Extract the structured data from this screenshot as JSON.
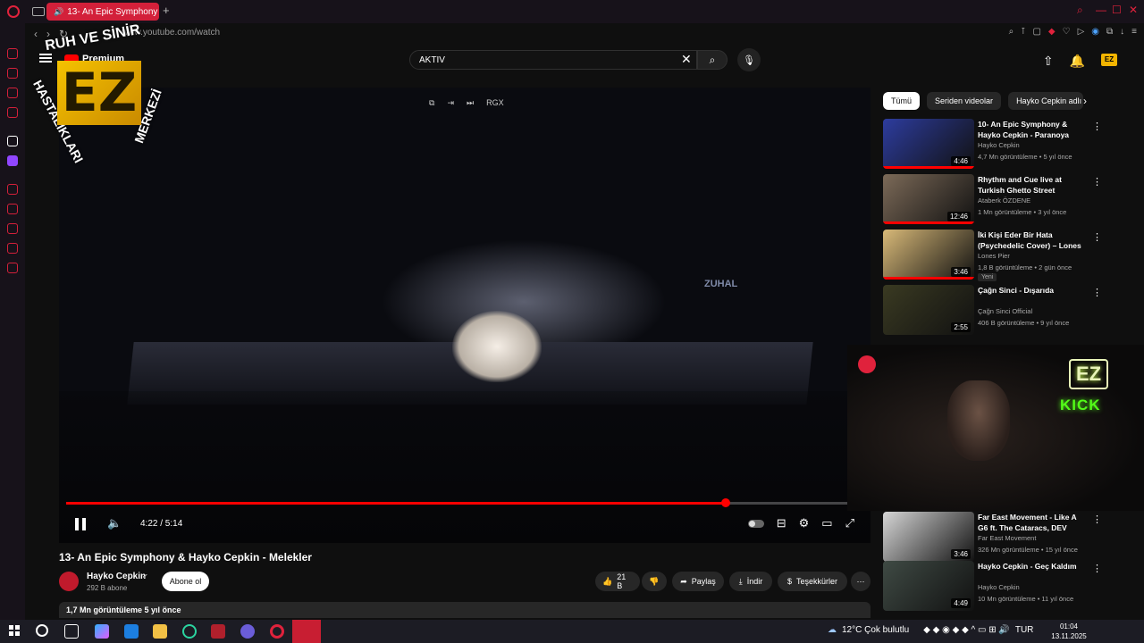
{
  "browser": {
    "tab_title": "13- An Epic Symphony",
    "url": "www.youtube.com/watch",
    "accent": "#d3203a"
  },
  "header": {
    "logo_text": "Premium",
    "search_value": "AKTIV"
  },
  "overlay": {
    "ring_text_top": "RUH VE SİNİR",
    "ring_text_left": "HASTALIKLARI",
    "ring_text_right": "MERKEZİ",
    "logo_letters": "EZ"
  },
  "player": {
    "stage_sign": "ZUHAL",
    "time": "4:22 / 5:14",
    "progress": 0.839,
    "top_icon_rgx": "RGX"
  },
  "video": {
    "title": "13- An Epic Symphony & Hayko Cepkin - Melekler",
    "channel": "Hayko Cepkin",
    "subscribers": "292 B abone",
    "subscribe_label": "Abone ol",
    "likes": "21 B",
    "share_label": "Paylaş",
    "download_label": "İndir",
    "thanks_label": "Teşekkürler",
    "views_date": "1,7 Mn görüntüleme  5 yıl önce"
  },
  "chips": [
    "Tümü",
    "Seriden videolar",
    "Hayko Cepkin adlı yü"
  ],
  "recommendations": [
    {
      "title": "10- An Epic Symphony & Hayko Cepkin - Paranoya",
      "channel": "Hayko Cepkin",
      "meta": "4,7 Mn görüntüleme • 5 yıl önce",
      "duration": "4:46",
      "watched": 1.0,
      "color": "#2d3c9e"
    },
    {
      "title": "Rhythm and Cue live at Turkish Ghetto Street",
      "channel": "Ataberk ÖZDENE",
      "meta": "1 Mn görüntüleme • 3 yıl önce",
      "duration": "12:46",
      "watched": 1.0,
      "color": "#7c6a58"
    },
    {
      "title": "İki Kişi Eder Bir Hata (Psychedelic Cover) – Lones ...",
      "channel": "Lones Pier",
      "meta": "1,8 B görüntüleme • 2 gün önce",
      "duration": "3:46",
      "watched": 1.0,
      "badge": "Yeni",
      "color": "#d8b978"
    },
    {
      "title": "Çağn Sinci - Dışarıda",
      "channel": "Çağn Sinci Official",
      "meta": "406 B görüntüleme • 9 yıl önce",
      "duration": "2:55",
      "watched": 0.0,
      "color": "#3a3a22"
    },
    {
      "title": "Far East Movement - Like A G6 ft. The Cataracs, DEV",
      "channel": "Far East Movement",
      "meta": "326 Mn görüntüleme • 15 yıl önce",
      "duration": "3:46",
      "watched": 0.0,
      "color": "#d6d6d6"
    },
    {
      "title": "Hayko Cepkin - Geç Kaldım",
      "channel": "Hayko Cepkin",
      "meta": "10 Mn görüntüleme • 11 yıl önce",
      "duration": "4:49",
      "watched": 0.0,
      "color": "#3f4a44"
    }
  ],
  "webcam": {
    "neon_logo": "EZ",
    "neon_text": "KICK"
  },
  "taskbar": {
    "weather": "12°C  Çok bulutlu",
    "language": "TUR",
    "time": "01:04",
    "date": "13.11.2025"
  }
}
